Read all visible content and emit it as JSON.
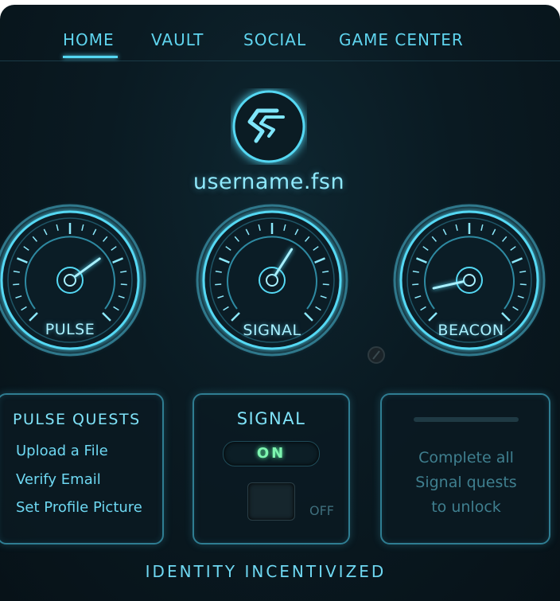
{
  "nav": {
    "items": [
      {
        "label": "HOME",
        "active": true
      },
      {
        "label": "VAULT",
        "active": false
      },
      {
        "label": "SOCIAL",
        "active": false
      },
      {
        "label": "GAME CENTER",
        "active": false
      }
    ]
  },
  "profile": {
    "logo_icon": "fsn-chevron-logo-icon",
    "username": "username.fsn"
  },
  "gauges": [
    {
      "label": "PULSE",
      "needle_level": 0.7
    },
    {
      "label": "SIGNAL",
      "needle_level": 0.62
    },
    {
      "label": "BEACON",
      "needle_level": 0.12
    }
  ],
  "pulse_panel": {
    "title": "PULSE QUESTS",
    "quests": [
      "Upload a File",
      "Verify Email",
      "Set Profile Picture"
    ]
  },
  "signal_panel": {
    "title": "SIGNAL",
    "on_label": "ON",
    "off_label": "OFF"
  },
  "locked_panel": {
    "message_lines": [
      "Complete all",
      "Signal quests",
      "to unlock"
    ]
  },
  "footer": {
    "tagline": "IDENTITY INCENTIVIZED"
  },
  "colors": {
    "accent": "#55d8f3",
    "on_green": "#7ef5b0",
    "background": "#0a1a22"
  }
}
